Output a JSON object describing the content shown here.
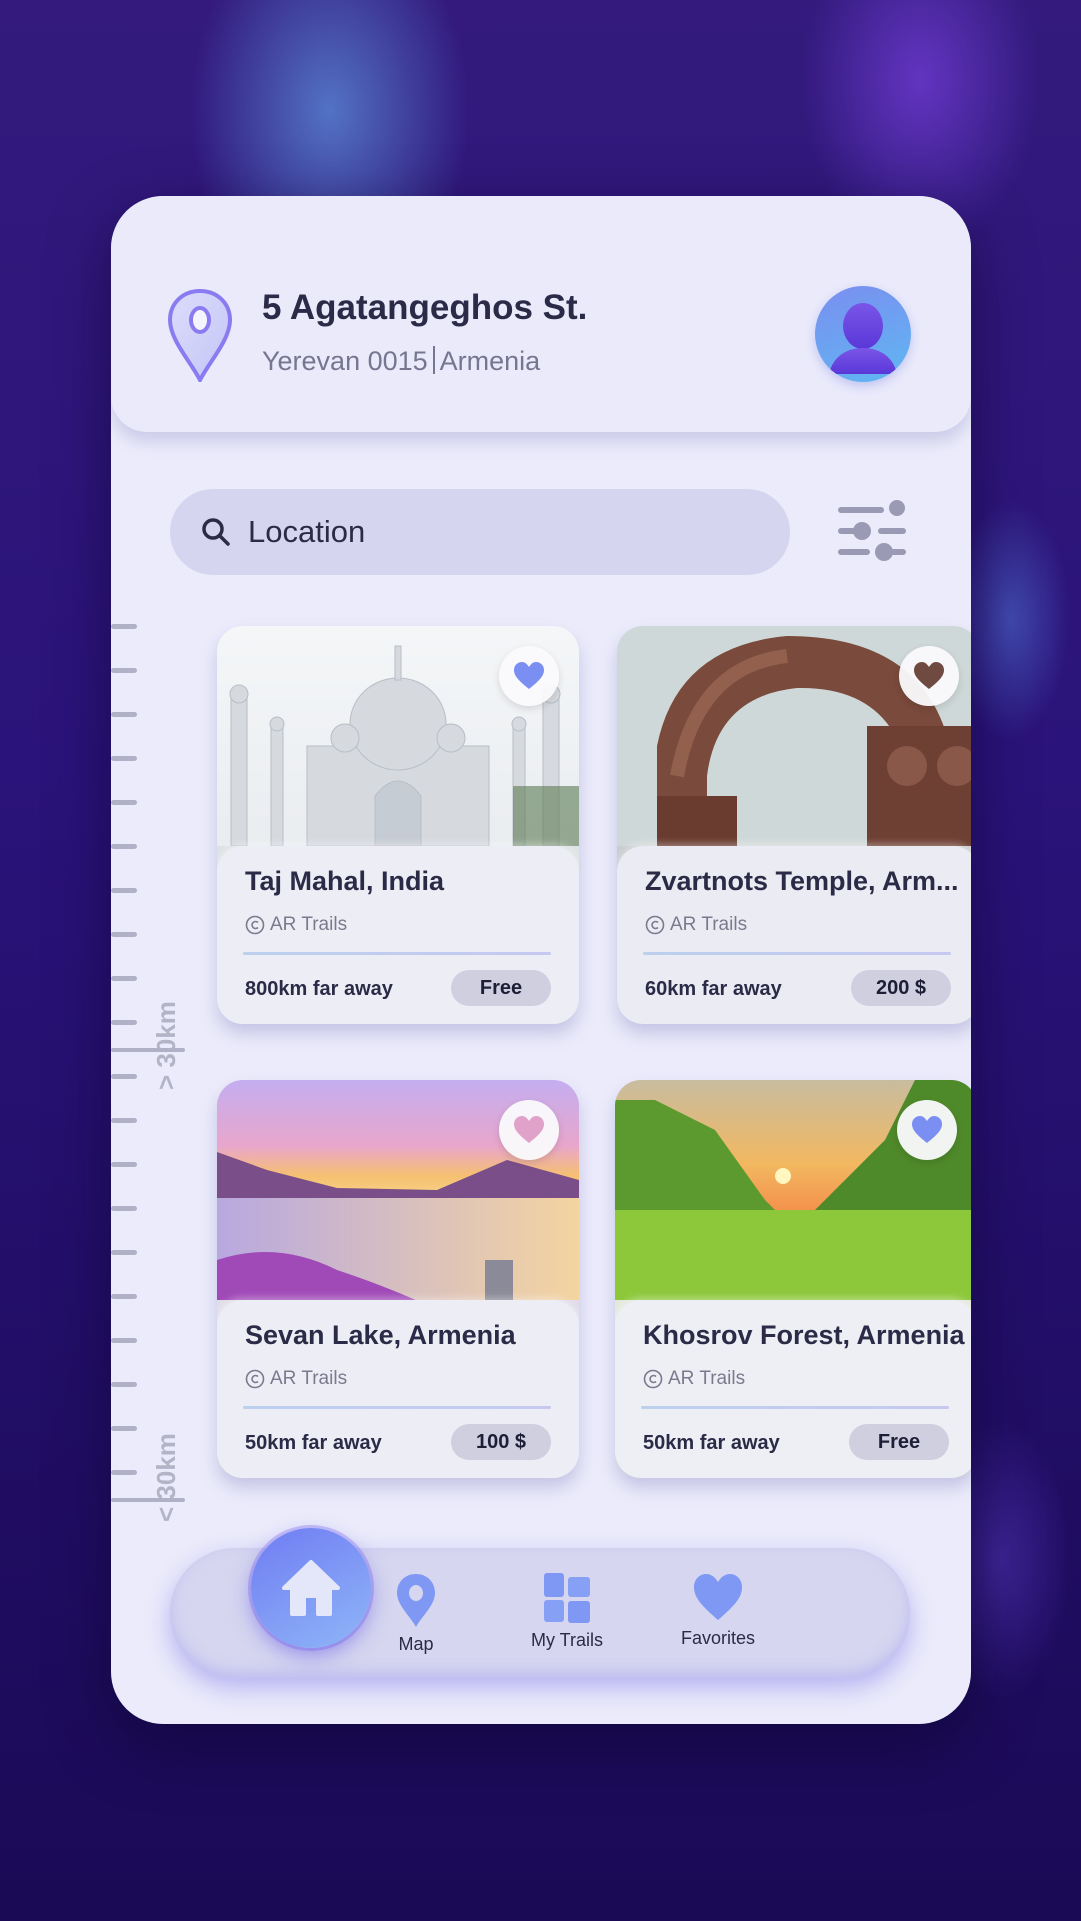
{
  "header": {
    "address_title": "5 Agatangeghos St.",
    "address_city": "Yerevan 0015",
    "address_country": "Armenia",
    "location_icon": "map-pin-icon",
    "avatar_icon": "user-avatar-icon"
  },
  "search": {
    "placeholder": "Location",
    "search_icon": "search-icon",
    "filter_icon": "sliders-icon"
  },
  "distance_ruler": {
    "upper_label": "> 30km",
    "lower_label": "< 30km"
  },
  "cards": [
    {
      "title": "Taj Mahal, India",
      "credit": "AR Trails",
      "distance": "800km far away",
      "price": "Free",
      "favorite": true,
      "image": "taj-mahal"
    },
    {
      "title": "Zvartnots Temple, Arm...",
      "credit": "AR Trails",
      "distance": "60km far away",
      "price": "200 $",
      "favorite": false,
      "image": "zvartnots-temple"
    },
    {
      "title": "Sevan Lake, Armenia",
      "credit": "AR Trails",
      "distance": "50km far away",
      "price": "100 $",
      "favorite": false,
      "image": "sevan-lake"
    },
    {
      "title": "Khosrov Forest, Armenia",
      "credit": "AR Trails",
      "distance": "50km far away",
      "price": "Free",
      "favorite": true,
      "image": "khosrov-forest"
    }
  ],
  "nav": {
    "active": "Home",
    "items": [
      {
        "label": "Map",
        "icon": "map-pin-icon"
      },
      {
        "label": "My Trails",
        "icon": "grid-icon"
      },
      {
        "label": "Favorites",
        "icon": "heart-icon"
      }
    ]
  },
  "colors": {
    "accent": "#7b8ff3",
    "background": "#2a137a",
    "surface": "#ebebfb",
    "text": "#2b2b48"
  }
}
